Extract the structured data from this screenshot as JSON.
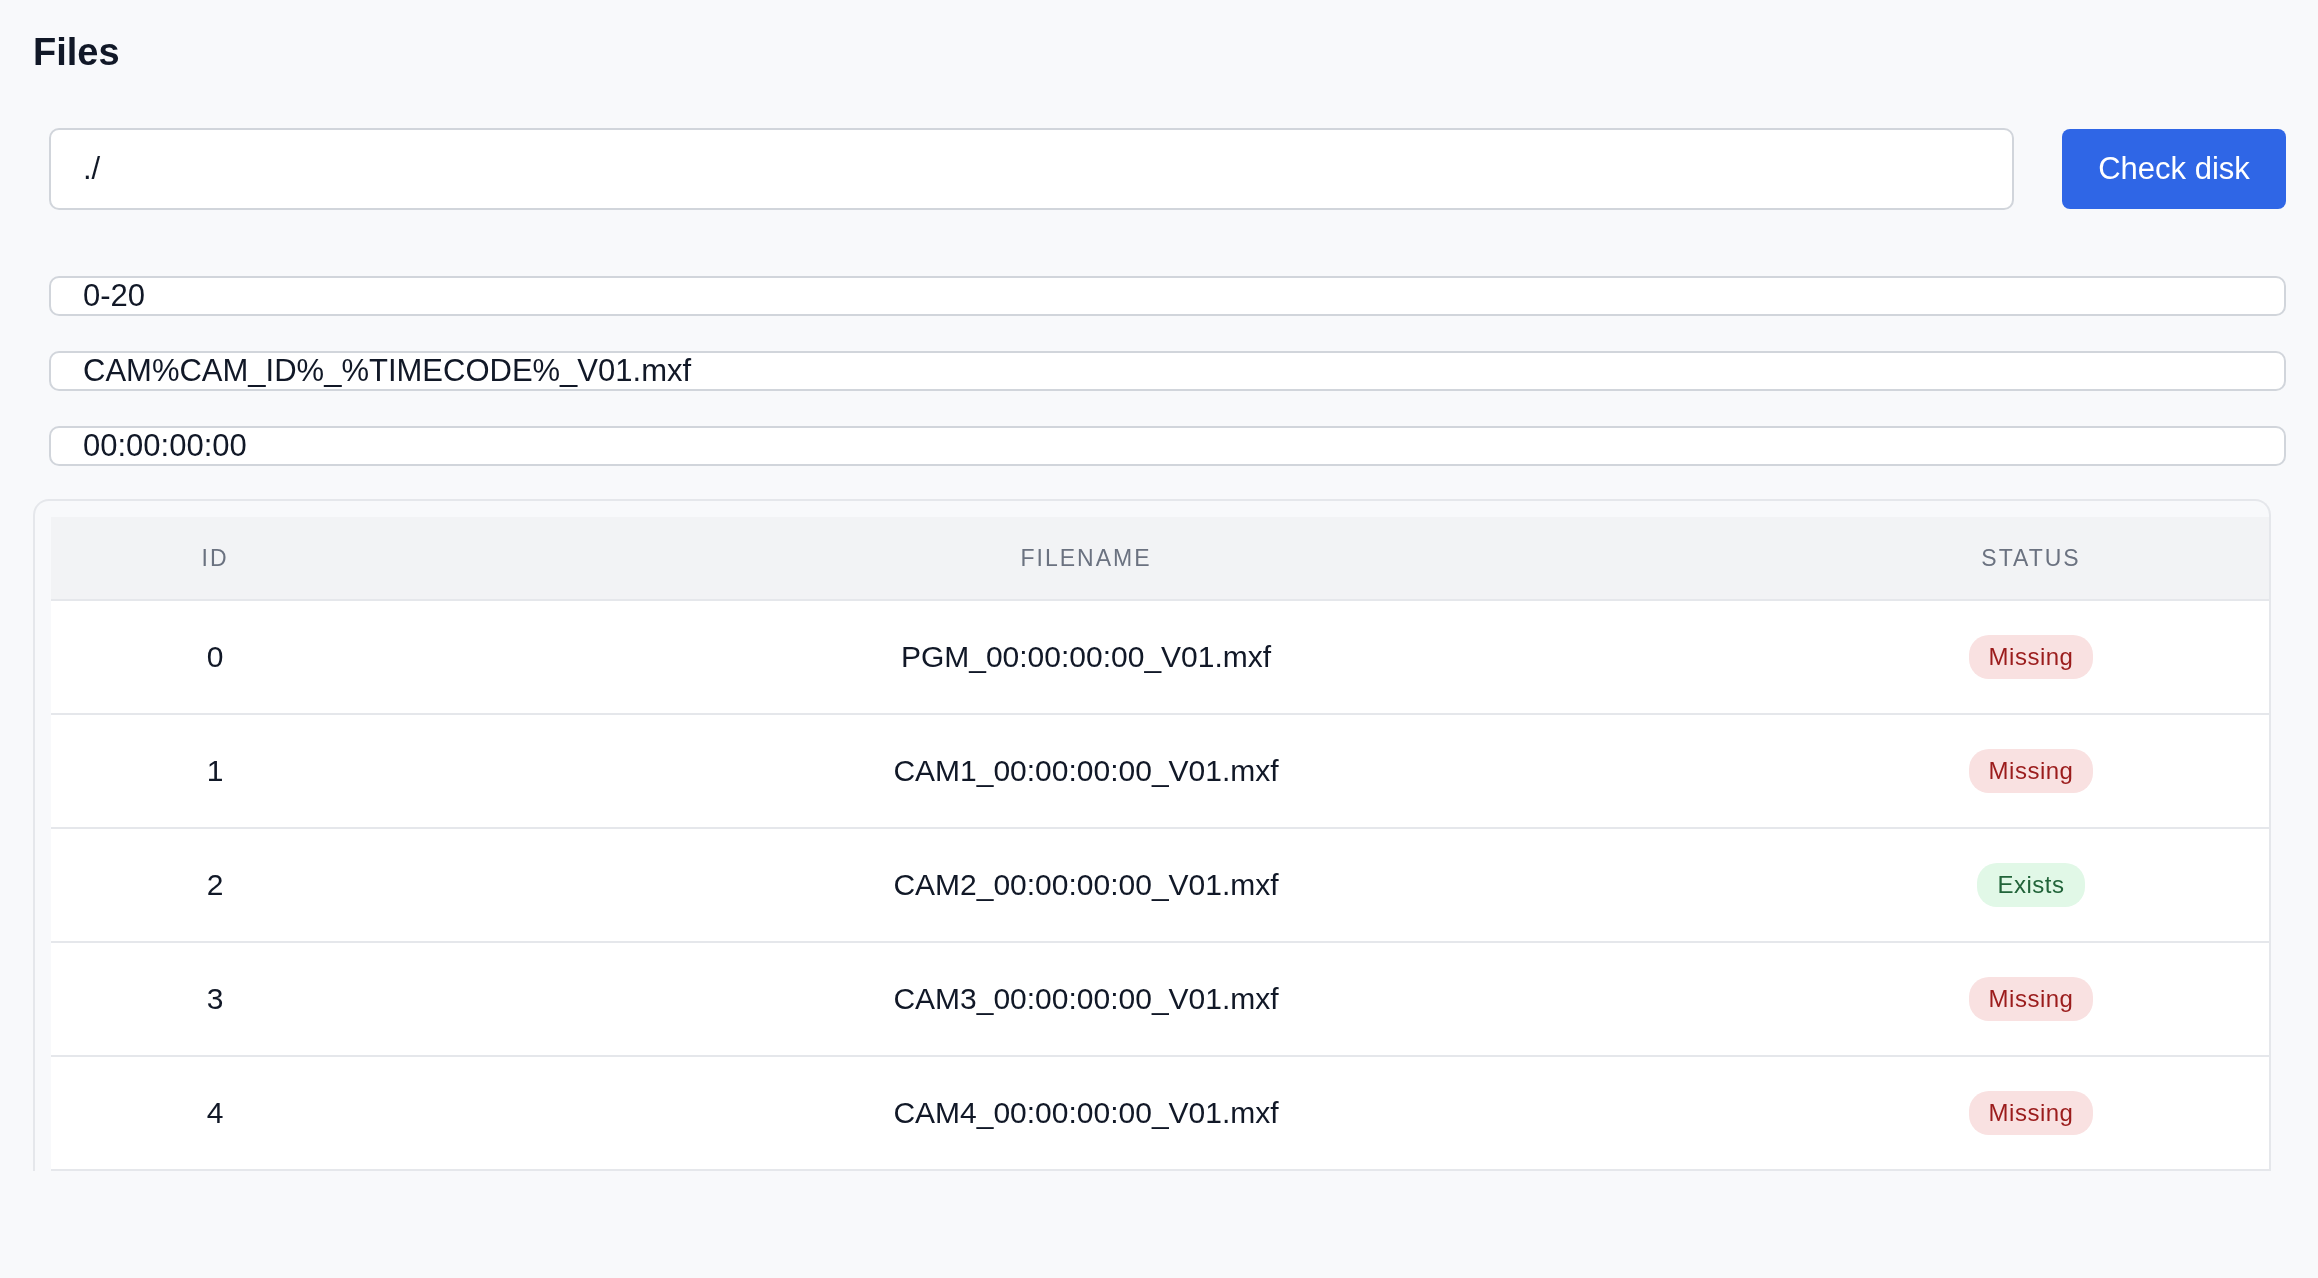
{
  "title": "Files",
  "path_field": {
    "value": "./"
  },
  "check_button": {
    "label": "Check disk"
  },
  "fields": [
    {
      "value": "0-20"
    },
    {
      "value": "CAM%CAM_ID%_%TIMECODE%_V01.mxf"
    },
    {
      "value": "00:00:00:00"
    }
  ],
  "table": {
    "columns": [
      "ID",
      "FILENAME",
      "STATUS"
    ],
    "rows": [
      {
        "id": "0",
        "filename": "PGM_00:00:00:00_V01.mxf",
        "status": {
          "label": "Missing",
          "kind": "missing"
        }
      },
      {
        "id": "1",
        "filename": "CAM1_00:00:00:00_V01.mxf",
        "status": {
          "label": "Missing",
          "kind": "missing"
        }
      },
      {
        "id": "2",
        "filename": "CAM2_00:00:00:00_V01.mxf",
        "status": {
          "label": "Exists",
          "kind": "exists"
        }
      },
      {
        "id": "3",
        "filename": "CAM3_00:00:00:00_V01.mxf",
        "status": {
          "label": "Missing",
          "kind": "missing"
        }
      },
      {
        "id": "4",
        "filename": "CAM4_00:00:00:00_V01.mxf",
        "status": {
          "label": "Missing",
          "kind": "missing"
        }
      }
    ]
  }
}
